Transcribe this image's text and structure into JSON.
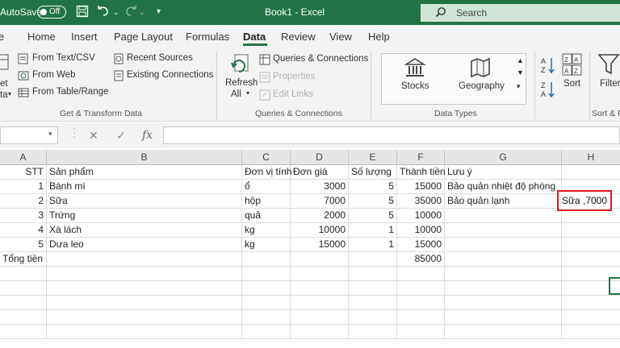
{
  "titlebar": {
    "autosave_label": "AutoSave",
    "autosave_state": "Off",
    "doc_title": "Book1  -  Excel",
    "search_placeholder": "Search"
  },
  "tabs": [
    "Home",
    "Insert",
    "Page Layout",
    "Formulas",
    "Data",
    "Review",
    "View",
    "Help"
  ],
  "active_tab": "Data",
  "ribbon": {
    "get_data_fragment": [
      "et",
      "ta"
    ],
    "from_text_csv": "From Text/CSV",
    "from_web": "From Web",
    "from_table_range": "From Table/Range",
    "recent_sources": "Recent Sources",
    "existing_connections": "Existing Connections",
    "group_get_transform": "Get & Transform Data",
    "refresh_all": [
      "Refresh",
      "All"
    ],
    "queries_connections": "Queries & Connections",
    "properties": "Properties",
    "edit_links": "Edit Links",
    "group_queries": "Queries & Connections",
    "stocks": "Stocks",
    "geography": "Geography",
    "group_data_types": "Data Types",
    "sort": "Sort",
    "filter": "Filter",
    "group_sort_filter": "Sort & Fi"
  },
  "formula_bar": {
    "fx_label": "fx",
    "cancel_symbol": "✕",
    "enter_symbol": "✓"
  },
  "columns": [
    "A",
    "B",
    "C",
    "D",
    "E",
    "F",
    "G",
    "H"
  ],
  "rows": [
    [
      "STT",
      "Sản phẩm",
      "Đơn vị tính",
      "Đơn giá",
      "Số lượng",
      "Thành tiền",
      "Lưu ý",
      ""
    ],
    [
      "1",
      "Bánh mì",
      "ổ",
      "3000",
      "5",
      "15000",
      "Bảo quản nhiệt độ phòng",
      ""
    ],
    [
      "2",
      "Sữa",
      "hộp",
      "7000",
      "5",
      "35000",
      "Bảo quản lạnh",
      ""
    ],
    [
      "3",
      "Trứng",
      "quả",
      "2000",
      "5",
      "10000",
      "",
      ""
    ],
    [
      "4",
      "Xà lách",
      "kg",
      "10000",
      "1",
      "10000",
      "",
      ""
    ],
    [
      "5",
      "Dưa leo",
      "kg",
      "15000",
      "1",
      "15000",
      "",
      ""
    ],
    [
      "Tổng tiền",
      "",
      "",
      "",
      "",
      "85000",
      "",
      ""
    ],
    [
      "",
      "",
      "",
      "",
      "",
      "",
      "",
      ""
    ],
    [
      "",
      "",
      "",
      "",
      "",
      "",
      "",
      ""
    ],
    [
      "",
      "",
      "",
      "",
      "",
      "",
      "",
      ""
    ],
    [
      "",
      "",
      "",
      "",
      "",
      "",
      "",
      ""
    ],
    [
      "",
      "",
      "",
      "",
      "",
      "",
      "",
      ""
    ]
  ],
  "callout_text": "Sữa ,7000",
  "colors": {
    "excel_green": "#217346",
    "callout_red": "#e0161c"
  }
}
